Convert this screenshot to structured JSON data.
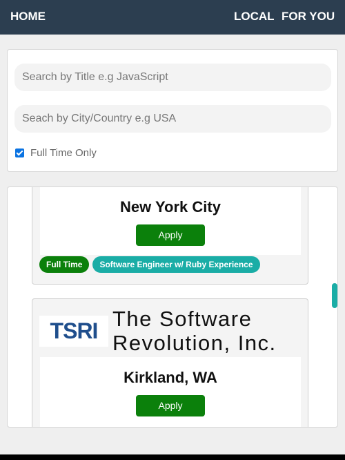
{
  "nav": {
    "home": "HOME",
    "local": "LOCAL",
    "for_you": "FOR YOU"
  },
  "search": {
    "title_placeholder": "Search by Title e.g JavaScript",
    "title_value": "",
    "city_placeholder": "Seach by City/Country e.g USA",
    "city_value": "",
    "full_time_label": "Full Time Only",
    "full_time_checked": true
  },
  "jobs": [
    {
      "location": "New York City",
      "apply_label": "Apply",
      "tags": [
        "Full Time",
        "Software Engineer w/ Ruby Experience"
      ]
    },
    {
      "logo_text": "TSRI",
      "company": "The Software Revolution, Inc.",
      "location": "Kirkland, WA",
      "apply_label": "Apply"
    }
  ],
  "colors": {
    "navbar": "#2c3e50",
    "apply": "#0b800b",
    "tag_title": "#1aada6",
    "checkbox": "#0b73e2"
  }
}
